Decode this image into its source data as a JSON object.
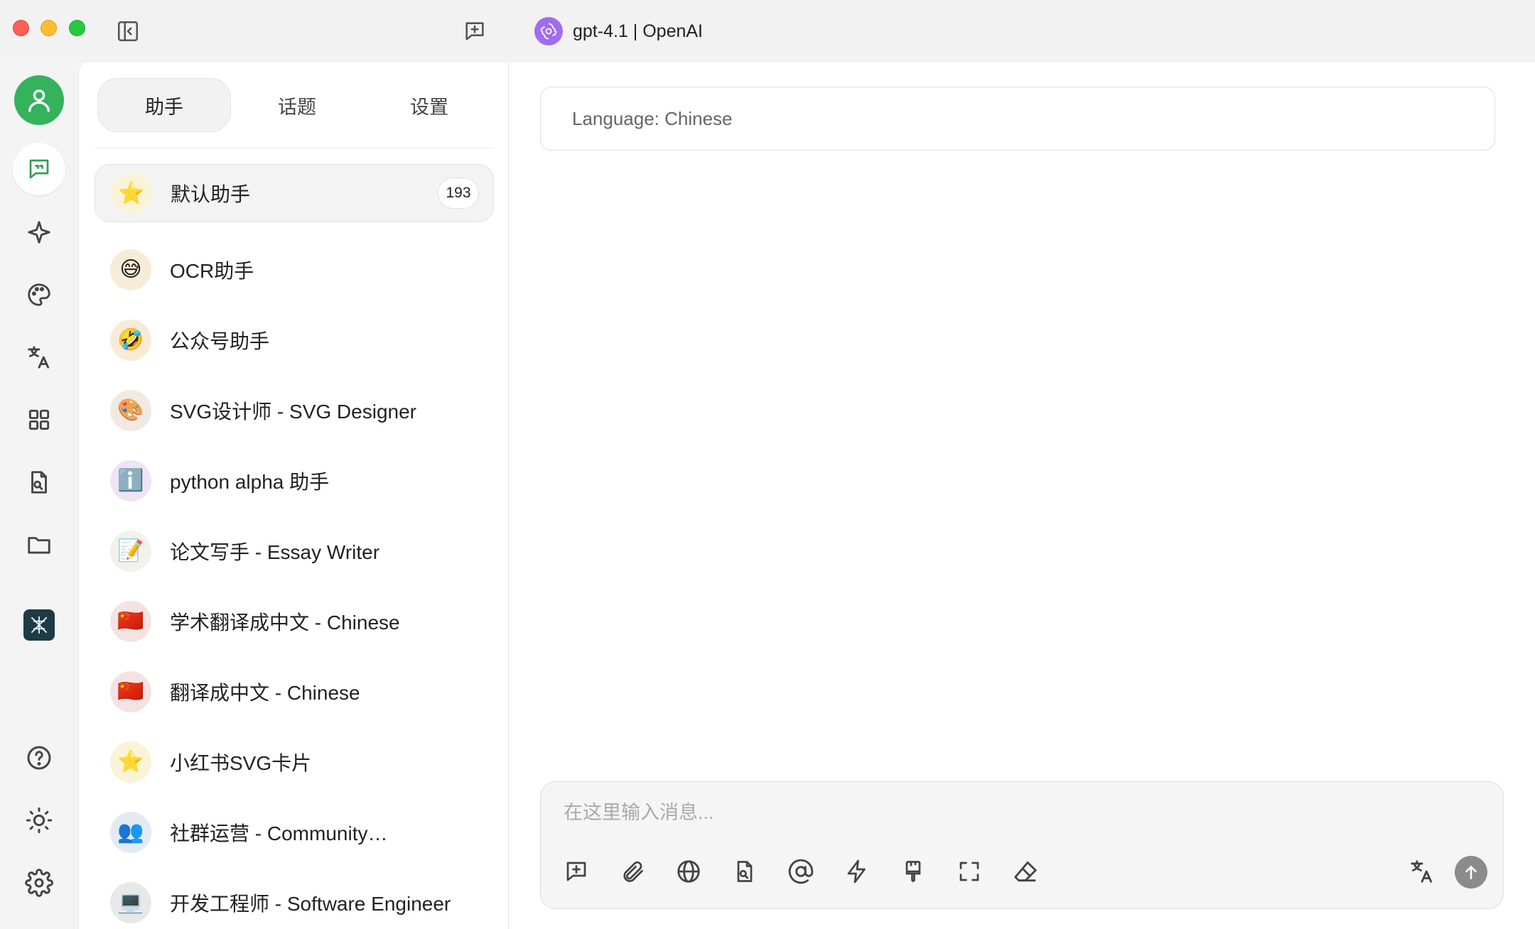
{
  "window": {
    "model_name": "gpt-4.1 | OpenAI"
  },
  "rail": {
    "items": [
      "user-avatar",
      "chat",
      "agents",
      "paint",
      "translate",
      "apps",
      "file-search",
      "files",
      "mini-app",
      "help",
      "theme",
      "settings"
    ]
  },
  "panel": {
    "tabs": [
      {
        "label": "助手",
        "active": true
      },
      {
        "label": "话题",
        "active": false
      },
      {
        "label": "设置",
        "active": false
      }
    ],
    "assistants": [
      {
        "label": "默认助手",
        "emoji": "⭐",
        "bg": "#fbf3d6",
        "count": "193",
        "active": true
      },
      {
        "label": "OCR助手",
        "emoji": "😅",
        "bg": "#f7ecd8"
      },
      {
        "label": "公众号助手",
        "emoji": "🤣",
        "bg": "#f7ecd8"
      },
      {
        "label": "SVG设计师 - SVG Designer",
        "emoji": "🎨",
        "bg": "#f1e9e2"
      },
      {
        "label": "python alpha 助手",
        "emoji": "ℹ️",
        "bg": "#efe3f5"
      },
      {
        "label": "论文写手 - Essay Writer",
        "emoji": "📝",
        "bg": "#f3f1ea"
      },
      {
        "label": "学术翻译成中文 - Chinese",
        "emoji": "🇨🇳",
        "bg": "#f5e3e3"
      },
      {
        "label": "翻译成中文 - Chinese",
        "emoji": "🇨🇳",
        "bg": "#f5e3e3"
      },
      {
        "label": "小红书SVG卡片",
        "emoji": "⭐",
        "bg": "#fbf3d6"
      },
      {
        "label": "社群运营 - Community…",
        "emoji": "👥",
        "bg": "#e4eaf3"
      },
      {
        "label": "开发工程师 - Software Engineer",
        "emoji": "💻",
        "bg": "#e8e8e8"
      }
    ]
  },
  "main": {
    "system_prompt": "Language: Chinese",
    "composer": {
      "placeholder": "在这里输入消息..."
    },
    "tools": [
      "new-topic",
      "attachment",
      "web-search",
      "knowledge-base",
      "mention",
      "quick-phrases",
      "clear-context",
      "expand",
      "eraser"
    ]
  },
  "colors": {
    "accent": "#34b25c",
    "model_logo": "#a06cf0"
  }
}
